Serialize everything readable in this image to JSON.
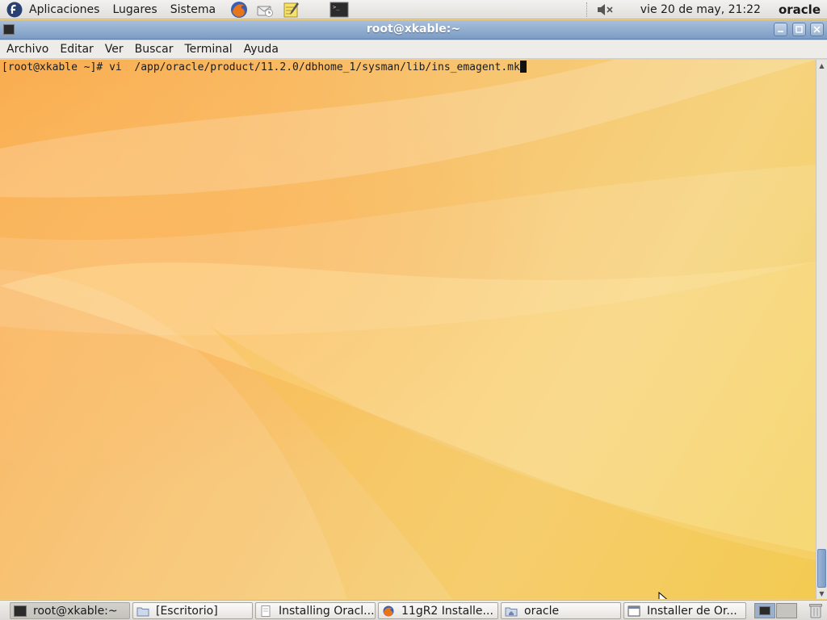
{
  "top_panel": {
    "menus": [
      "Aplicaciones",
      "Lugares",
      "Sistema"
    ],
    "launchers": [
      "firefox-icon",
      "mail-icon",
      "notes-icon",
      "terminal-icon"
    ],
    "clock": "vie 20 de may, 21:22",
    "user": "oracle"
  },
  "window": {
    "title": "root@xkable:~",
    "menu": [
      "Archivo",
      "Editar",
      "Ver",
      "Buscar",
      "Terminal",
      "Ayuda"
    ]
  },
  "terminal": {
    "prompt": "[root@xkable ~]# ",
    "command": "vi  /app/oracle/product/11.2.0/dbhome_1/sysman/lib/ins_emagent.mk"
  },
  "taskbar": {
    "tasks": [
      {
        "label": "root@xkable:~",
        "icon": "terminal-icon",
        "active": true
      },
      {
        "label": "[Escritorio]",
        "icon": "folder-icon",
        "active": false
      },
      {
        "label": "Installing Oracl...",
        "icon": "document-icon",
        "active": false
      },
      {
        "label": "11gR2 Installe...",
        "icon": "firefox-icon",
        "active": false
      },
      {
        "label": "oracle",
        "icon": "home-folder-icon",
        "active": false
      },
      {
        "label": "Installer de Or...",
        "icon": "window-icon",
        "active": false
      }
    ]
  },
  "colors": {
    "titlebar": "#7c9cc4",
    "wallpaper_orange": "#f9a94b",
    "wallpaper_yellow": "#f1cf55"
  }
}
